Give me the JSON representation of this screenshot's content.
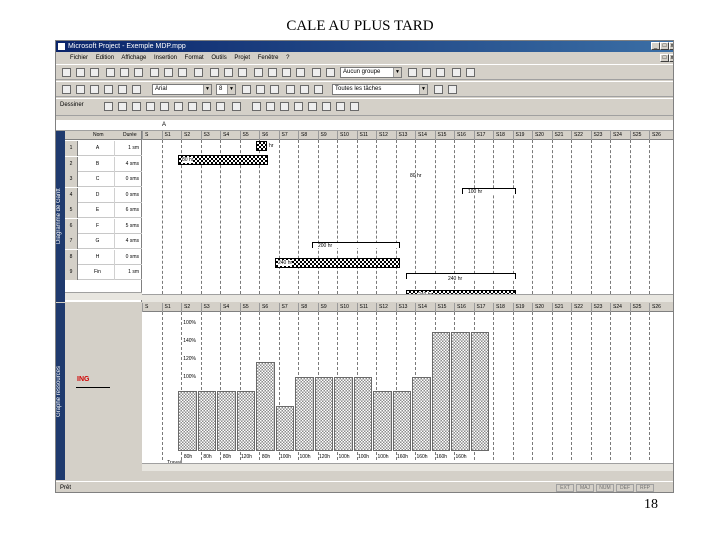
{
  "slide": {
    "title": "CALE AU PLUS TARD",
    "page_number": "18"
  },
  "window": {
    "title": "Microsoft Project - Exemple MDP.mpp",
    "menu": [
      "Fichier",
      "Edition",
      "Affichage",
      "Insertion",
      "Format",
      "Outils",
      "Projet",
      "Fenêtre",
      "?"
    ],
    "toolbar": {
      "group_combo": "Aucun groupe",
      "font_combo": "Arial",
      "size_combo": "8",
      "filter_combo": "Toutes les tâches",
      "draw_label": "Dessiner"
    },
    "edit_value": "A"
  },
  "sidebar": {
    "top_label": "Diagramme de Gantt",
    "bottom_label": "Graphe ressources"
  },
  "grid": {
    "headers": [
      "Nom",
      "Durée"
    ],
    "rows": [
      {
        "id": "1",
        "name": "A",
        "duration": "1 sm"
      },
      {
        "id": "2",
        "name": "B",
        "duration": "4 sms"
      },
      {
        "id": "3",
        "name": "C",
        "duration": "0 sms"
      },
      {
        "id": "4",
        "name": "D",
        "duration": "0 sms"
      },
      {
        "id": "5",
        "name": "E",
        "duration": "6 sms"
      },
      {
        "id": "6",
        "name": "F",
        "duration": "5 sms"
      },
      {
        "id": "7",
        "name": "G",
        "duration": "4 sms"
      },
      {
        "id": "8",
        "name": "H",
        "duration": "0 sms"
      },
      {
        "id": "9",
        "name": "Fin",
        "duration": "1 sm"
      }
    ]
  },
  "timescale": [
    "S",
    "S1",
    "S2",
    "S3",
    "S4",
    "S5",
    "S6",
    "S7",
    "S8",
    "S9",
    "S10",
    "S11",
    "S12",
    "S13",
    "S14",
    "S15",
    "S16",
    "S17",
    "S18",
    "S19",
    "S20",
    "S21",
    "S22",
    "S23",
    "S24",
    "S25",
    "S26"
  ],
  "bars": [
    {
      "label": "hr",
      "type": "hatch"
    },
    {
      "label": "80 hr",
      "type": "hatch"
    },
    {
      "label": "80 hr",
      "type": "plain"
    },
    {
      "label": "100 hr",
      "type": "white"
    },
    {
      "label": "200 hr",
      "type": "white"
    },
    {
      "label": "240 hr",
      "type": "hatch"
    },
    {
      "label": "240 hr",
      "type": "white"
    },
    {
      "label": "240 hr",
      "type": "hatch"
    }
  ],
  "resource_chart": {
    "resource_name": "ING",
    "y_ticks": [
      "100%",
      "140%",
      "120%",
      "100%",
      "80%",
      "60%",
      "40%",
      "20%"
    ],
    "row_label": "Travail",
    "work_labels": [
      "80h",
      "80h",
      "80h",
      "120h",
      "80h",
      "100h",
      "100h",
      "120h",
      "100h",
      "100h",
      "100h",
      "160h",
      "160h",
      "160h",
      "160h"
    ],
    "chart_data": {
      "type": "bar",
      "categories": [
        "S1",
        "S2",
        "S3",
        "S4",
        "S5",
        "S6",
        "S7",
        "S8",
        "S9",
        "S10",
        "S11",
        "S12",
        "S13",
        "S14",
        "S15",
        "S16"
      ],
      "values": [
        80,
        80,
        80,
        80,
        120,
        60,
        100,
        100,
        100,
        100,
        80,
        80,
        100,
        160,
        160,
        160
      ],
      "ylabel": "",
      "ylim": [
        0,
        180
      ]
    }
  },
  "status": {
    "left": "Prêt",
    "indicators": [
      "EXT",
      "MAJ",
      "NUM",
      "DEF",
      "RFP"
    ]
  }
}
